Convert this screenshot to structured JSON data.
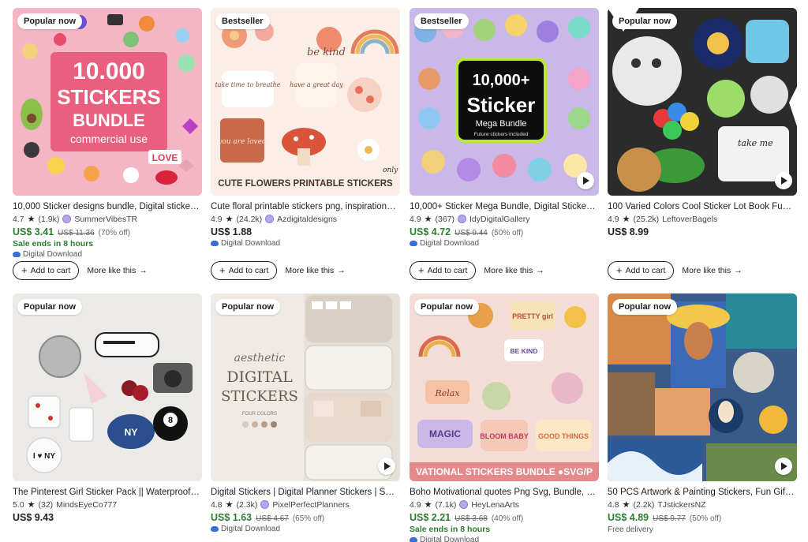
{
  "colors": {
    "sale_green": "#2e7d32",
    "accent_blue": "#3a6fd8"
  },
  "icons": {
    "star": "★",
    "arrow": "→",
    "plus": "+"
  },
  "row1": [
    {
      "badge": "Popular now",
      "title": "10,000 Sticker designs bundle, Digital sticker ...",
      "rating": "4.7",
      "reviews": "(1.9k)",
      "shop": "SummerVibesTR",
      "price": "US$ 3.41",
      "original_price": "US$ 11.36",
      "discount": "(70% off)",
      "sale_ends": "Sale ends in 8 hours",
      "download": "Digital Download",
      "thumb_text": {
        "line1": "10.000",
        "line2": "STICKERS",
        "line3": "BUNDLE",
        "line4": "commercial use",
        "love": "LOVE"
      },
      "add_to_cart": "Add to cart",
      "more_like": "More like this"
    },
    {
      "badge": "Bestseller",
      "title": "Cute floral printable stickers png, inspirationa...",
      "rating": "4.9",
      "reviews": "(24.2k)",
      "shop": "Azdigitaldesigns",
      "price": "US$ 1.88",
      "download": "Digital Download",
      "thumb_text": {
        "banner": "CUTE FLOWERS PRINTABLE STICKERS",
        "s1": "be kind",
        "s2": "take time to breathe",
        "s3": "have a great day",
        "s4": "you are loved",
        "s5": "only"
      },
      "add_to_cart": "Add to cart",
      "more_like": "More like this"
    },
    {
      "badge": "Bestseller",
      "title": "10,000+ Sticker Mega Bundle, Digital Sticker P...",
      "rating": "4.9",
      "reviews": "(367)",
      "shop": "IdyDigitalGallery",
      "price": "US$ 4.72",
      "original_price": "US$ 9.44",
      "discount": "(50% off)",
      "download": "Digital Download",
      "thumb_text": {
        "line1": "10,000+",
        "line2": "Sticker",
        "line3": "Mega Bundle",
        "line4": "Future stickers included"
      },
      "add_to_cart": "Add to cart",
      "more_like": "More like this"
    },
    {
      "badge": "Popular now",
      "title": "100 Varied Colors Cool Sticker Lot Book Fun P...",
      "rating": "4.9",
      "reviews": "(25.2k)",
      "shop": "LeftoverBagels",
      "price": "US$ 8.99",
      "thumb_text": {
        "s1": "take me"
      },
      "add_to_cart": "Add to cart",
      "more_like": "More like this"
    }
  ],
  "row2": [
    {
      "badge": "Popular now",
      "title": "The Pinterest Girl Sticker Pack || Waterproof St...",
      "rating": "5.0",
      "reviews": "(32)",
      "shop": "MindsEyeCo777",
      "price": "US$ 9.43",
      "thumb_text": {
        "ny": "I ♥ NY",
        "cap": "NY",
        "ball": "8"
      }
    },
    {
      "badge": "Popular now",
      "title": "Digital Stickers | Digital Planner Stickers | STIC...",
      "rating": "4.8",
      "reviews": "(2.3k)",
      "shop": "PixelPerfectPlanners",
      "price": "US$ 1.63",
      "original_price": "US$ 4.67",
      "discount": "(65% off)",
      "download": "Digital Download",
      "thumb_text": {
        "line1": "aesthetic",
        "line2": "DIGITAL",
        "line3": "STICKERS",
        "line4": "FOUR COLORS"
      }
    },
    {
      "badge": "Popular now",
      "title": "Boho Motivational quotes Png Svg, Bundle, In...",
      "rating": "4.9",
      "reviews": "(7.1k)",
      "shop": "HeyLenaArts",
      "price": "US$ 2.21",
      "original_price": "US$ 3.68",
      "discount": "(40% off)",
      "sale_ends": "Sale ends in 8 hours",
      "download": "Digital Download",
      "thumb_text": {
        "banner": "VATIONAL STICKERS BUNDLE ●SVG/P",
        "s1": "PRETTY girl",
        "s2": "BE KIND",
        "s3": "Relax",
        "s4": "MAGIC",
        "s5": "BLOOM BABY",
        "s6": "GOOD THINGS"
      }
    },
    {
      "badge": "Popular now",
      "title": "50 PCS Artwork & Painting Stickers, Fun Gift V...",
      "rating": "4.8",
      "reviews": "(2.2k)",
      "shop": "TJstickersNZ",
      "price": "US$ 4.89",
      "original_price": "US$ 9.77",
      "discount": "(50% off)",
      "free_delivery": "Free delivery"
    }
  ]
}
